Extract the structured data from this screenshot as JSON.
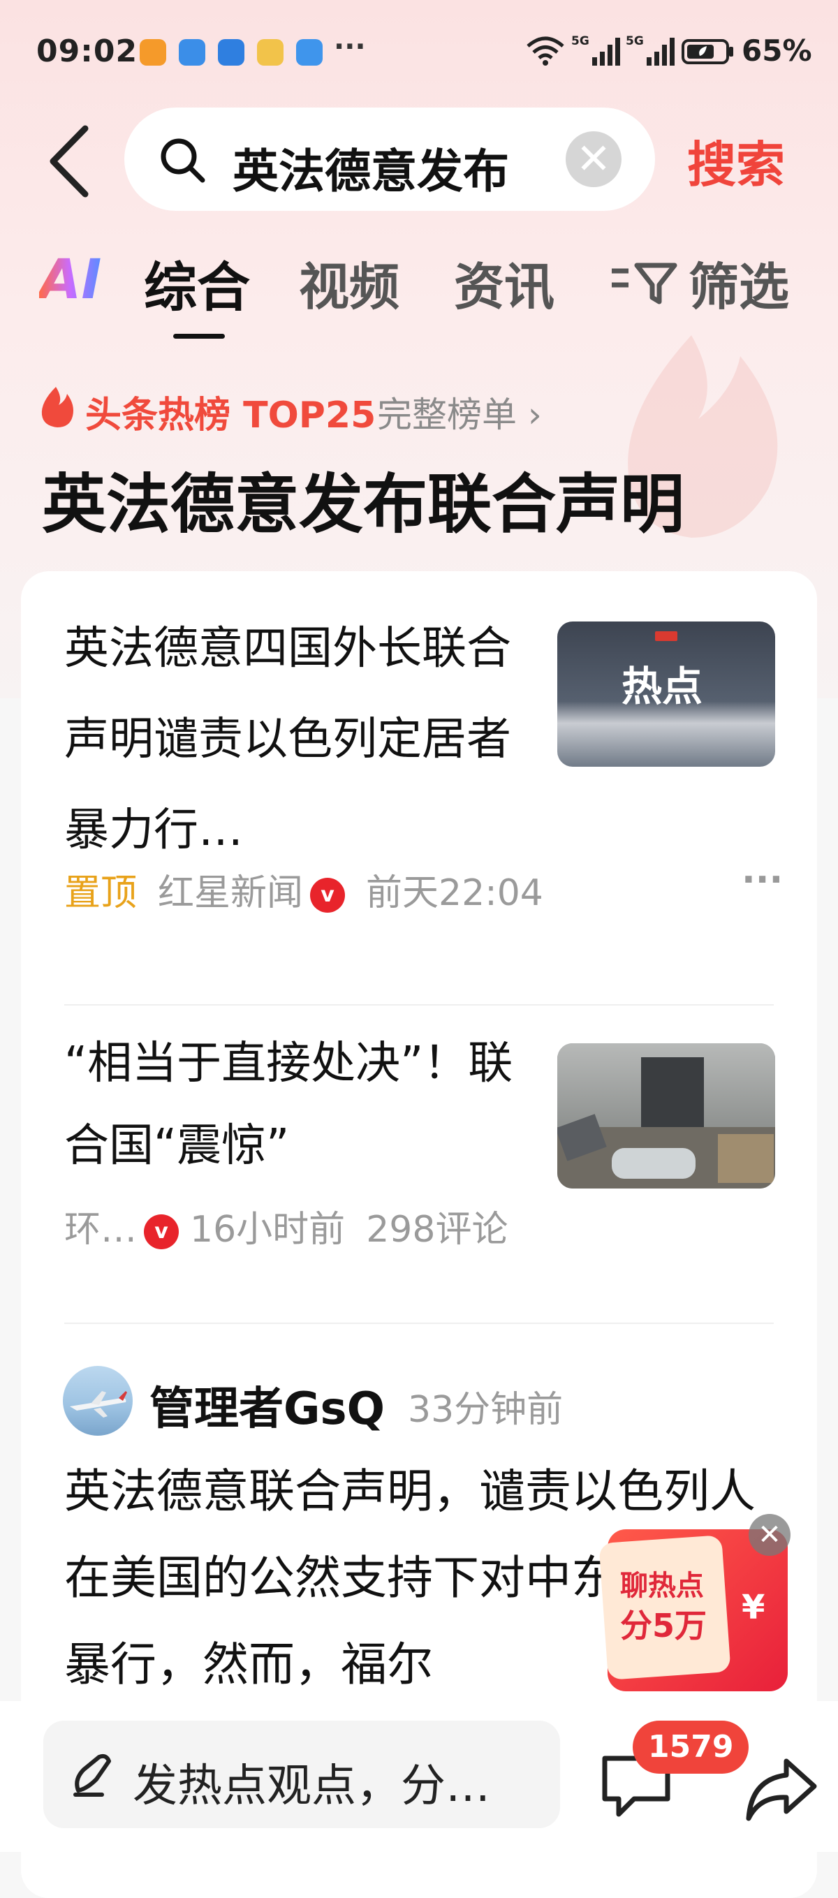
{
  "status_bar": {
    "time": "09:02",
    "battery": "65%",
    "more": "···"
  },
  "search": {
    "query": "英法德意发布",
    "button_label": "搜索",
    "clear_glyph": "✕"
  },
  "tabs": {
    "ai": "AI",
    "items": [
      "综合",
      "视频",
      "资讯"
    ],
    "filter": "筛选",
    "active_index": 0
  },
  "hot": {
    "label": "头条热榜 TOP25",
    "link": "完整榜单 ›",
    "title": "英法德意发布联合声明"
  },
  "articles": [
    {
      "title": "英法德意四国外长联合声明谴责以色列定居者暴力行…",
      "pin": "置顶",
      "source": "红星新闻",
      "verified_glyph": "v",
      "time": "前天22:04",
      "thumb_text": "热点",
      "menu_glyph": "···"
    },
    {
      "title": "“相当于直接处决”！联合国“震惊”",
      "source": "环…",
      "verified_glyph": "v",
      "time": "16小时前",
      "comments": "298评论"
    }
  ],
  "post": {
    "author": "管理者GsQ",
    "time": "33分钟前",
    "text": "英法德意联合声明，谴责以色列人在美国的公然支持下对中东国家的暴行，然而，福尔"
  },
  "floating": {
    "line1": "聊热点",
    "line2": "分5万",
    "currency": "¥",
    "close": "✕"
  },
  "bottom_bar": {
    "placeholder": "发热点观点，分…",
    "comment_count": "1579"
  },
  "colors": {
    "accent": "#f0443b",
    "pin": "#e8a21a",
    "verified": "#e8242b"
  }
}
